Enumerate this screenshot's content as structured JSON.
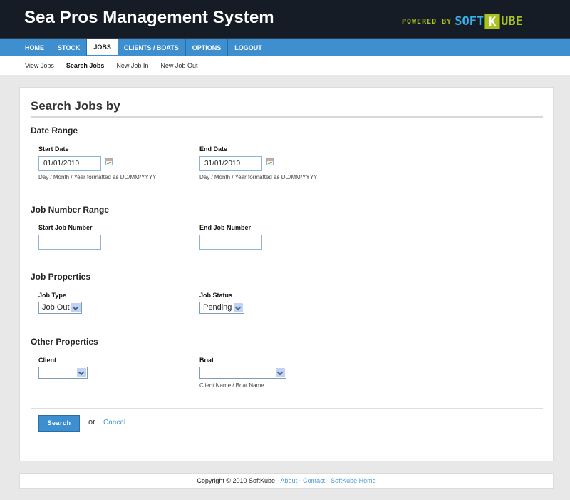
{
  "header": {
    "title": "Sea Pros Management System",
    "powered_by": "POWERED BY",
    "brand_part1": "SOFT",
    "brand_k": "K",
    "brand_part2": "UBE"
  },
  "nav": {
    "items": [
      {
        "label": "HOME"
      },
      {
        "label": "STOCK"
      },
      {
        "label": "JOBS",
        "active": true
      },
      {
        "label": "CLIENTS / BOATS"
      },
      {
        "label": "OPTIONS"
      },
      {
        "label": "LOGOUT"
      }
    ]
  },
  "subnav": {
    "items": [
      {
        "label": "View Jobs"
      },
      {
        "label": "Search Jobs",
        "active": true
      },
      {
        "label": "New Job In"
      },
      {
        "label": "New Job Out"
      }
    ]
  },
  "form": {
    "title": "Search Jobs by",
    "date_range": {
      "legend": "Date Range",
      "start_label": "Start Date",
      "start_value": "01/01/2010",
      "end_label": "End Date",
      "end_value": "31/01/2010",
      "hint": "Day / Month / Year formatted as DD/MM/YYYY"
    },
    "job_number_range": {
      "legend": "Job Number Range",
      "start_label": "Start Job Number",
      "start_value": "",
      "end_label": "End Job Number",
      "end_value": ""
    },
    "job_properties": {
      "legend": "Job Properties",
      "type_label": "Job Type",
      "type_value": "Job Out",
      "status_label": "Job Status",
      "status_value": "Pending"
    },
    "other_properties": {
      "legend": "Other Properties",
      "client_label": "Client",
      "client_value": "",
      "boat_label": "Boat",
      "boat_value": "",
      "boat_hint": "Client Name / Boat Name"
    },
    "actions": {
      "search_label": "Search",
      "or_text": "or",
      "cancel_label": "Cancel"
    }
  },
  "footer": {
    "copyright": "Copyright © 2010 SoftKube - ",
    "about": "About",
    "sep1": " - ",
    "contact": "Contact",
    "sep2": " - ",
    "home": "SoftKube Home"
  },
  "colors": {
    "header_bg": "#151c26",
    "nav_bg": "#3d8fd0",
    "accent_green": "#a9c21f",
    "accent_blue": "#35b2ea",
    "link": "#4a9bd6"
  }
}
